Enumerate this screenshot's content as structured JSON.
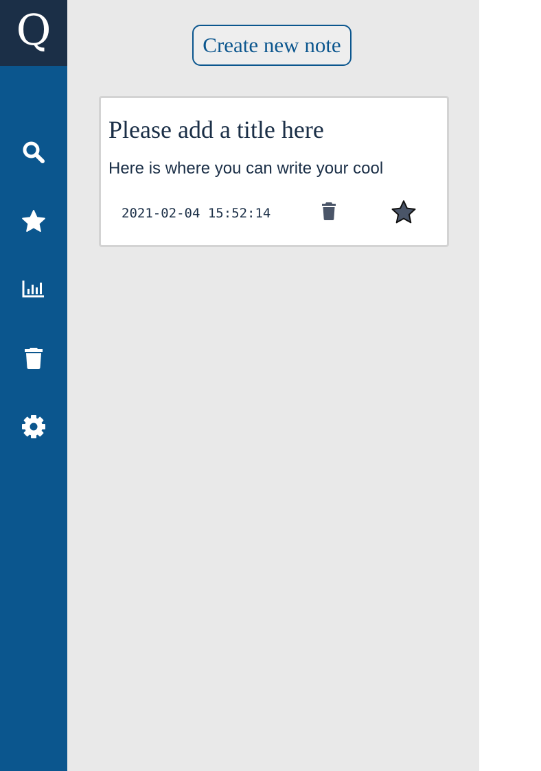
{
  "sidebar": {
    "logo": "Q",
    "items": [
      {
        "icon": "search-icon"
      },
      {
        "icon": "star-icon"
      },
      {
        "icon": "chart-icon"
      },
      {
        "icon": "trash-icon"
      },
      {
        "icon": "gear-icon"
      }
    ],
    "colors": {
      "background": "#0b568e",
      "logo_background": "#1b2f47"
    }
  },
  "main": {
    "create_button_label": "Create new note",
    "notes": [
      {
        "title": "Please add a title here",
        "body": "Here is where you can write your cool",
        "timestamp": "2021-02-04 15:52:14",
        "actions": [
          "trash-icon",
          "star-icon"
        ]
      }
    ]
  }
}
